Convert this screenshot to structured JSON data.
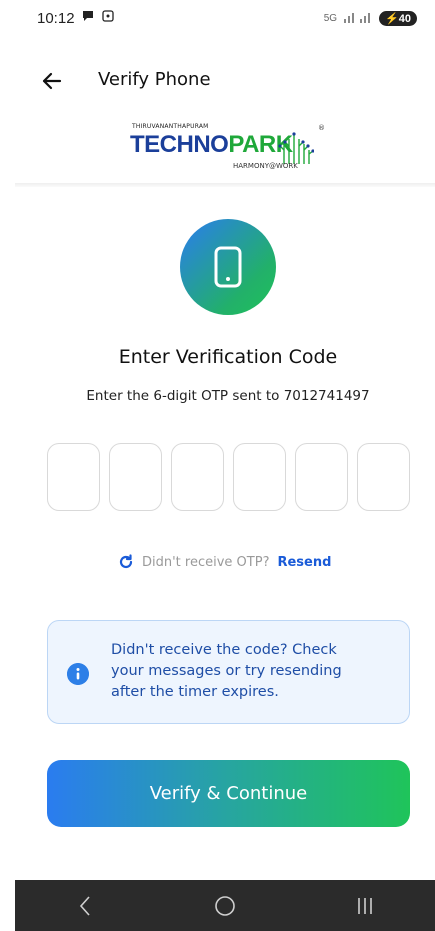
{
  "status_bar": {
    "time": "10:12",
    "network": "5G",
    "battery": "40"
  },
  "app_bar": {
    "title": "Verify Phone",
    "back_icon": "arrow-left-icon"
  },
  "logo": {
    "city": "THIRUVANANTHAPURAM",
    "brand_part1": "TECHNO",
    "brand_part2": "PARK",
    "tagline": "HARMONY@WORK",
    "registered": "®"
  },
  "verification": {
    "heading": "Enter Verification Code",
    "subtext": "Enter the 6-digit OTP sent to 7012741497",
    "otp_digits": [
      "",
      "",
      "",
      "",
      "",
      ""
    ],
    "resend_prompt": "Didn't receive OTP?",
    "resend_link": "Resend"
  },
  "info_card": {
    "text": "Didn't receive the code? Check your messages or try resending after the timer expires."
  },
  "cta": {
    "label": "Verify & Continue"
  },
  "colors": {
    "primary_blue": "#2a7cf0",
    "primary_green": "#1fc45a",
    "link_blue": "#1a5bd8",
    "info_bg": "#eef5fe"
  }
}
